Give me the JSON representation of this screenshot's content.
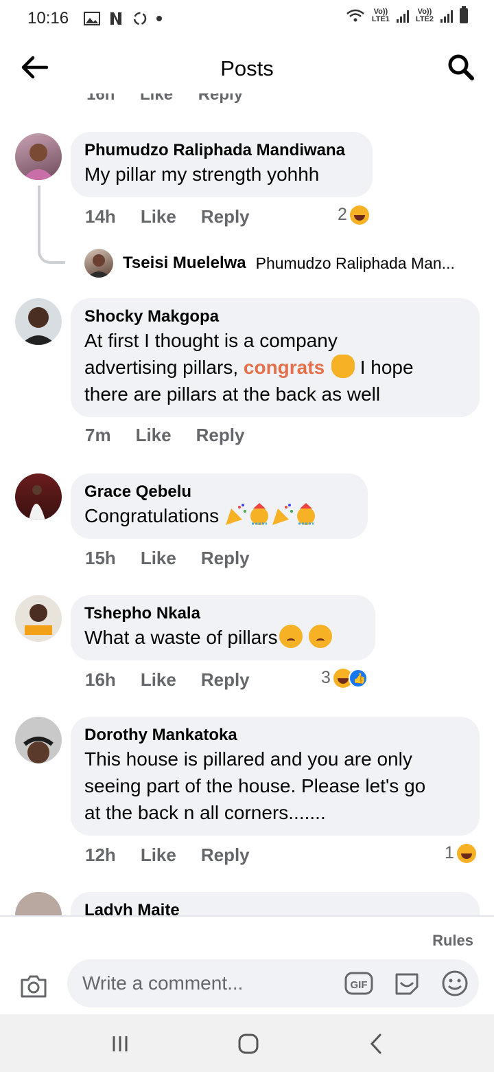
{
  "status": {
    "time": "10:16",
    "lte1": "LTE1",
    "lte2": "LTE2",
    "volte": "Vo))"
  },
  "header": {
    "title": "Posts"
  },
  "feed": {
    "cutoff_row": "16h Like Reply",
    "comments": [
      {
        "name": "Phumudzo Raliphada Mandiwana",
        "lines": [
          "My pillar my strength yohhh"
        ],
        "time": "14h",
        "like": "Like",
        "reply": "Reply",
        "reaction_count": "2"
      },
      {
        "name": "Shocky Makgopa",
        "line1": "At first I thought is a company",
        "line2_pre": "advertising pillars,",
        "line2_hl": "congrats",
        "line2_post": "I hope",
        "line3": "there are pillars at the back as well",
        "time": "7m",
        "like": "Like",
        "reply": "Reply"
      },
      {
        "name": "Grace Qebelu",
        "text": "Congratulations",
        "time": "15h",
        "like": "Like",
        "reply": "Reply"
      },
      {
        "name": "Tshepho Nkala",
        "text": "What a waste of pillars",
        "time": "16h",
        "like": "Like",
        "reply": "Reply",
        "reaction_count": "3"
      },
      {
        "name": "Dorothy Mankatoka",
        "lines": [
          "This house is pillared and you are only",
          "seeing part of the house. Please let's go",
          "at the back n all corners......."
        ],
        "time": "12h",
        "like": "Like",
        "reply": "Reply",
        "reaction_count": "1"
      },
      {
        "name": "Ladyh Maite"
      }
    ],
    "reply_preview": {
      "name": "Tseisi Muelelwa",
      "text": "Phumudzo Raliphada Man..."
    }
  },
  "composer": {
    "rules": "Rules",
    "placeholder": "Write a comment..."
  },
  "colors": {
    "bubble": "#f0f2f5",
    "meta": "#65676b",
    "highlight": "#e4704b",
    "haha": "#f7b125",
    "like": "#1877f2"
  }
}
